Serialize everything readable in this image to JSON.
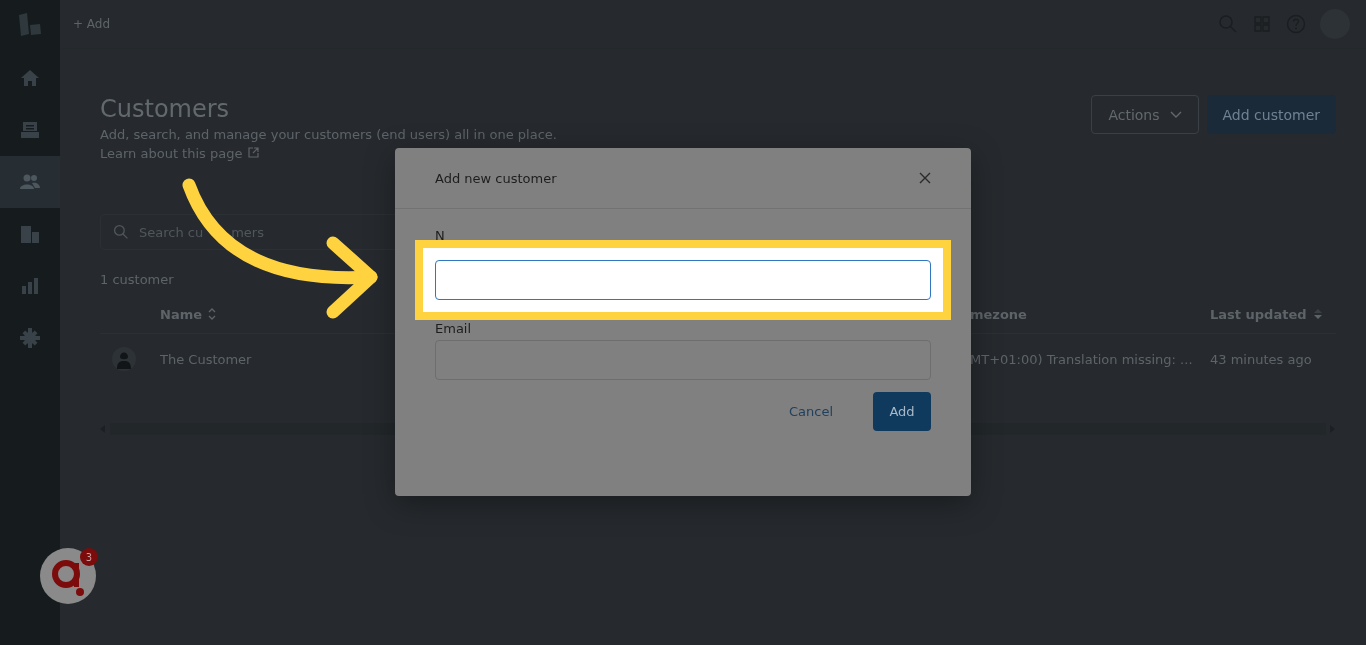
{
  "topbar": {
    "add_label": "+ Add"
  },
  "sidebar": {
    "items": [
      {
        "kind": "home",
        "selected": false
      },
      {
        "kind": "book",
        "selected": false
      },
      {
        "kind": "people",
        "selected": true
      },
      {
        "kind": "building",
        "selected": false
      },
      {
        "kind": "chart",
        "selected": false
      },
      {
        "kind": "gear",
        "selected": false
      }
    ]
  },
  "page": {
    "title": "Customers",
    "description": "Add, search, and manage your customers (end users) all in one place.",
    "learn_link": "Learn about this page",
    "actions_button": "Actions",
    "add_button": "Add customer",
    "search": {
      "placeholder_parts": [
        "Search cu",
        "mers"
      ]
    },
    "count": "1 customer"
  },
  "table": {
    "columns": [
      {
        "label": "Name",
        "kind": "sortable"
      },
      {
        "label": "mezone",
        "kind": "plain"
      },
      {
        "label": "Last updated",
        "kind": "sorted"
      }
    ],
    "rows": [
      {
        "name": "The Customer",
        "timezone": "MT+01:00) Translation missing: ...",
        "updated": "43 minutes ago"
      }
    ]
  },
  "dialog": {
    "title": "Add new customer",
    "fields": [
      {
        "label": "N",
        "highlighted": true
      },
      {
        "label": "Email",
        "highlighted": false
      }
    ],
    "cancel": "Cancel",
    "confirm": "Add"
  },
  "widget": {
    "badge": "3"
  }
}
